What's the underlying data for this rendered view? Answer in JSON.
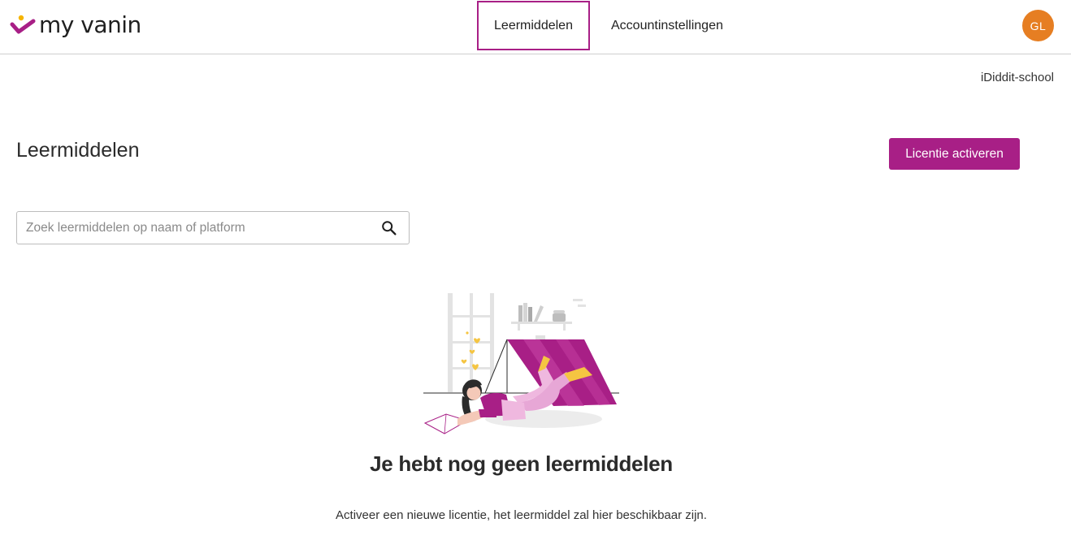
{
  "header": {
    "logo_text": "my vanin",
    "nav": [
      {
        "label": "Leermiddelen",
        "active": true
      },
      {
        "label": "Accountinstellingen",
        "active": false
      }
    ],
    "avatar_initials": "GL"
  },
  "school_name": "iDiddit-school",
  "main": {
    "title": "Leermiddelen",
    "activate_button": "Licentie activeren",
    "search": {
      "placeholder": "Zoek leermiddelen op naam of platform",
      "value": ""
    },
    "empty_state": {
      "title": "Je hebt nog geen leermiddelen",
      "description": "Activeer een nieuwe licentie, het leermiddel zal hier beschikbaar zijn."
    }
  },
  "icons": {
    "logo": "check-with-dot-icon",
    "search": "search-icon",
    "empty_state": "girl-reading-under-tent-illustration"
  },
  "colors": {
    "brand": "#a81f86",
    "logo_dot": "#f5b400",
    "avatar": "#e67e22",
    "border": "#cfcfcf"
  }
}
